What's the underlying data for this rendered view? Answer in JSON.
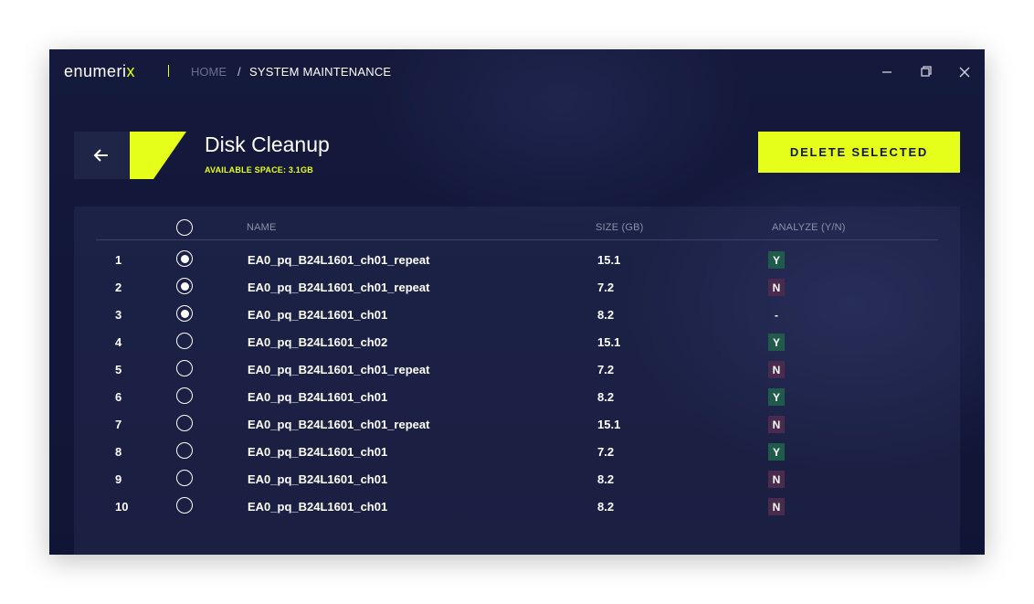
{
  "app": {
    "logo_main": "enumeri",
    "logo_accent": "x"
  },
  "breadcrumb": {
    "home": "HOME",
    "separator": "/",
    "current": "SYSTEM MAINTENANCE"
  },
  "window_controls": {
    "minimize_icon": "minimize-icon",
    "maximize_icon": "restore-icon",
    "close_icon": "close-icon"
  },
  "header": {
    "back_icon": "arrow-left-icon",
    "title": "Disk Cleanup",
    "subtitle": "AVAILABLE SPACE: 3.1GB",
    "delete_label": "DELETE SELECTED"
  },
  "table": {
    "columns": {
      "name": "NAME",
      "size": "SIZE (GB)",
      "analyze": "ANALYZE (Y/N)"
    },
    "rows": [
      {
        "num": "1",
        "selected": true,
        "name": "EA0_pq_B24L1601_ch01_repeat",
        "size": "15.1",
        "analyze": "Y"
      },
      {
        "num": "2",
        "selected": true,
        "name": "EA0_pq_B24L1601_ch01_repeat",
        "size": "7.2",
        "analyze": "N"
      },
      {
        "num": "3",
        "selected": true,
        "name": "EA0_pq_B24L1601_ch01",
        "size": "8.2",
        "analyze": "-"
      },
      {
        "num": "4",
        "selected": false,
        "name": "EA0_pq_B24L1601_ch02",
        "size": "15.1",
        "analyze": "Y"
      },
      {
        "num": "5",
        "selected": false,
        "name": "EA0_pq_B24L1601_ch01_repeat",
        "size": "7.2",
        "analyze": "N"
      },
      {
        "num": "6",
        "selected": false,
        "name": "EA0_pq_B24L1601_ch01",
        "size": "8.2",
        "analyze": "Y"
      },
      {
        "num": "7",
        "selected": false,
        "name": "EA0_pq_B24L1601_ch01_repeat",
        "size": "15.1",
        "analyze": "N"
      },
      {
        "num": "8",
        "selected": false,
        "name": "EA0_pq_B24L1601_ch01",
        "size": "7.2",
        "analyze": "Y"
      },
      {
        "num": "9",
        "selected": false,
        "name": "EA0_pq_B24L1601_ch01",
        "size": "8.2",
        "analyze": "N"
      },
      {
        "num": "10",
        "selected": false,
        "name": "EA0_pq_B24L1601_ch01",
        "size": "8.2",
        "analyze": "N"
      }
    ]
  },
  "colors": {
    "accent": "#e6ff1a",
    "background": "#12173a",
    "badge_yes": "#1f5a4a",
    "badge_no": "#4a2b4e"
  }
}
